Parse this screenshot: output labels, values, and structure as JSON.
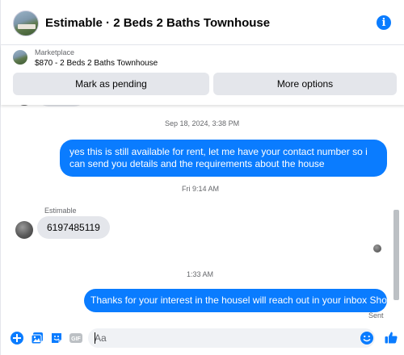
{
  "header": {
    "title": "Estimable · 2 Beds 2 Baths Townhouse",
    "info_icon": "info-icon",
    "info_glyph": "i"
  },
  "marketplace": {
    "label": "Marketplace",
    "listing": "$870 - 2 Beds 2 Baths Townhouse",
    "mark_pending_label": "Mark as pending",
    "more_options_label": "More options"
  },
  "conversation": {
    "timestamp_1": "Sep 18, 2024, 3:38 PM",
    "message_out_1": "yes this is still available for rent, let me have your contact number so i can send you details and the requirements about the house",
    "timestamp_2": "Fri 9:14 AM",
    "sender_name": "Estimable",
    "message_in_1": "6197485119",
    "timestamp_3": "1:33 AM",
    "message_out_2": "Thanks for your interest in the housel will reach out in your inbox Shortly",
    "status": "Sent"
  },
  "composer": {
    "placeholder": "Aa",
    "value": "",
    "icons": [
      "plus-icon",
      "photo-icon",
      "sticker-icon",
      "gif-icon",
      "emoji-icon",
      "thumbs-up-icon"
    ],
    "gif_label": "GIF"
  },
  "colors": {
    "accent": "#0a7cff",
    "bubble_incoming": "#e4e6eb",
    "button_bg": "#e4e6eb",
    "secondary_text": "#65676b"
  }
}
